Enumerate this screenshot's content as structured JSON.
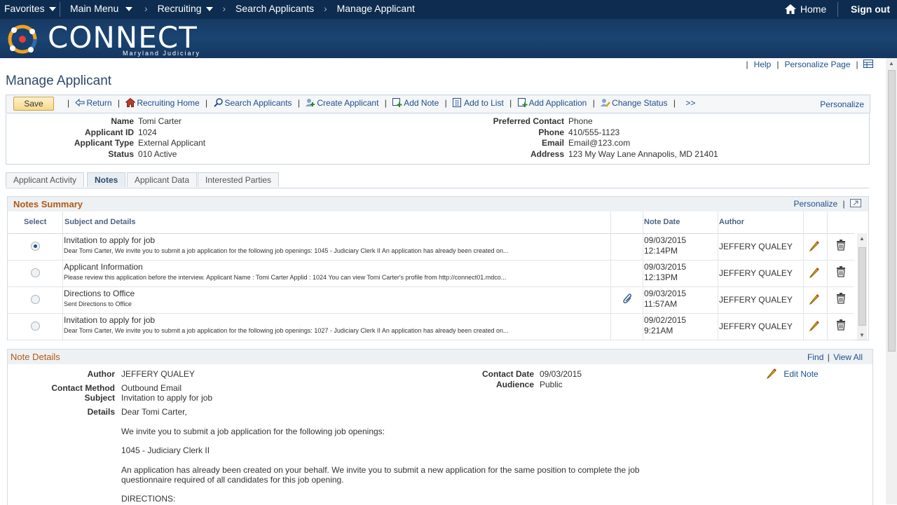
{
  "topnav": {
    "favorites": "Favorites",
    "main_menu": "Main Menu",
    "breadcrumbs": [
      "Recruiting",
      "Search Applicants",
      "Manage Applicant"
    ],
    "home": "Home",
    "signout": "Sign out"
  },
  "banner": {
    "brand": "CONNECT",
    "sub": "Maryland Judiciary"
  },
  "toplinks": {
    "help": "Help",
    "personalize_page": "Personalize Page"
  },
  "page": {
    "title": "Manage Applicant"
  },
  "toolbar": {
    "save": "Save",
    "return": "Return",
    "recruiting_home": "Recruiting Home",
    "search_applicants": "Search Applicants",
    "create_applicant": "Create Applicant",
    "add_note": "Add Note",
    "add_to_list": "Add to List",
    "add_application": "Add Application",
    "change_status": "Change Status",
    "more": ">>",
    "personalize": "Personalize"
  },
  "applicant": {
    "name_label": "Name",
    "name": "Tomi Carter",
    "id_label": "Applicant ID",
    "id": "1024",
    "type_label": "Applicant Type",
    "type": "External Applicant",
    "status_label": "Status",
    "status": "010 Active",
    "contact_label": "Preferred Contact",
    "contact": "Phone",
    "phone_label": "Phone",
    "phone": "410/555-1123",
    "email_label": "Email",
    "email": "Email@123.com",
    "address_label": "Address",
    "address": "123 My Way Lane Annapolis, MD 21401"
  },
  "tabs": [
    "Applicant Activity",
    "Notes",
    "Applicant Data",
    "Interested Parties"
  ],
  "notes_summary": {
    "title": "Notes Summary",
    "personalize": "Personalize",
    "columns": {
      "select": "Select",
      "subject": "Subject and Details",
      "date": "Note Date",
      "author": "Author"
    },
    "rows": [
      {
        "subject": "Invitation to apply for job",
        "details": "Dear Tomi Carter, We invite you to submit a job application for the following job openings: 1045 - Judiciary Clerk II An application has already been created on...",
        "date": "09/03/2015",
        "time": "12:14PM",
        "author": "JEFFERY QUALEY"
      },
      {
        "subject": "Applicant Information",
        "details": "Please review this application before the interview. Applicant Name : Tomi Carter Applid : 1024 You can view Tomi Carter's profile from http://connect01.mdco...",
        "date": "09/03/2015",
        "time": "12:13PM",
        "author": "JEFFERY QUALEY"
      },
      {
        "subject": "Directions to Office",
        "details": "Sent Directions to Office",
        "date": "09/03/2015",
        "time": "11:57AM",
        "author": "JEFFERY QUALEY"
      },
      {
        "subject": "Invitation to apply for job",
        "details": "Dear Tomi Carter, We invite you to submit a job application for the following job openings: 1027 - Judiciary Clerk II An application has already been created on...",
        "date": "09/02/2015",
        "time": "9:21AM",
        "author": "JEFFERY QUALEY"
      }
    ]
  },
  "note_details": {
    "title": "Note Details",
    "find": "Find",
    "view_all": "View All",
    "edit_note": "Edit Note",
    "author_label": "Author",
    "author": "JEFFERY QUALEY",
    "method_label": "Contact Method",
    "method": "Outbound Email",
    "subject_label": "Subject",
    "subject": "Invitation to apply for job",
    "details_label": "Details",
    "date_label": "Contact Date",
    "date": "09/03/2015",
    "audience_label": "Audience",
    "audience": "Public",
    "body": [
      "Dear Tomi Carter,",
      "We invite you to submit a job application for the following job openings:",
      "1045 - Judiciary Clerk II",
      "An application has already been created on your behalf. We invite you to submit a new application for the same position to complete the job questionnaire required of all candidates for this job opening.",
      "DIRECTIONS:"
    ]
  }
}
